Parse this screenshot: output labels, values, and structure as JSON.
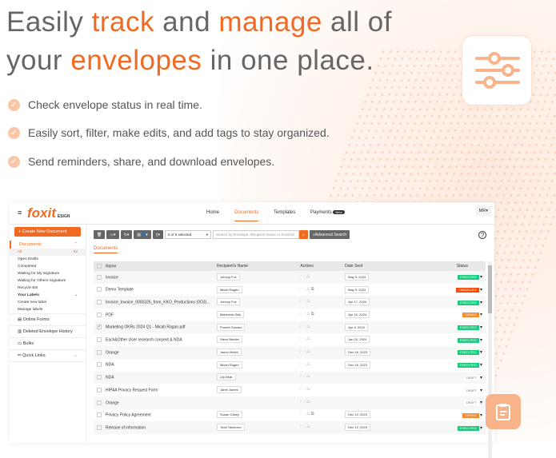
{
  "headline": {
    "l1a": "Easily ",
    "l1b": "track",
    "l1c": " and ",
    "l1d": "manage",
    "l1e": " all of",
    "l2a": "your ",
    "l2b": "envelopes",
    "l2c": " in one place."
  },
  "bullets": [
    "Check envelope status in real time.",
    "Easily sort, filter, make edits, and add tags to stay organized.",
    "Send reminders, share, and download envelopes."
  ],
  "app": {
    "logo": "foxit",
    "logo_sub": "ESIGN",
    "nav": [
      "Home",
      "Documents",
      "Templates",
      "Payments"
    ],
    "beta": "Beta",
    "user": "MR",
    "create": "+ Create New Document",
    "sidebar": {
      "documents": "Documents",
      "all": "All",
      "all_count": "62",
      "items": [
        "Open Drafts",
        "Completed",
        "Waiting for My Signature",
        "Waiting for Others Signature",
        "Recycle Bin"
      ],
      "labels": "Your Labels",
      "label_items": [
        "Create new label",
        "Manage labels"
      ],
      "big": [
        "Online Forms",
        "Deleted Envelope History",
        "Bulks",
        "Quick Links"
      ]
    },
    "toolbar": {
      "selected": "6 of 6 selected",
      "search_placeholder": "Search by Envelope, Recipient Name or Email Id",
      "advanced": "Advanced Search"
    },
    "tab": "Documents",
    "columns": [
      "Name",
      "Recipient's Name",
      "Actions",
      "Date Sent",
      "Status"
    ],
    "rows": [
      {
        "name": "Invoice",
        "recipient": "Johnny Fox",
        "date": "May 9, 2024",
        "status": "EXECUTED"
      },
      {
        "name": "Demo Template",
        "recipient": "Micah Ragen",
        "date": "May 9, 2024",
        "status": "CANCELLED"
      },
      {
        "name": "Invoice_Invoice_0000326_from_KKO_Productions (0O3)...",
        "recipient": "Johnny Fox",
        "date": "Apr 17, 2024",
        "status": "EXECUTED"
      },
      {
        "name": "PDF",
        "recipient": "Mahender Bist",
        "date": "Apr 10, 2024",
        "status": "SIGNED"
      },
      {
        "name": "Marketing OKRs 2024 Q1 - Micah Ragan.pdf",
        "recipient": "Puneet Golvani",
        "date": "Apr 9, 2024",
        "status": "EXECUTED",
        "checked": true
      },
      {
        "name": "Each&Other User research consent & NDA",
        "recipient": "Steve Bentler",
        "date": "Jan 24, 2024",
        "status": "EXECUTED"
      },
      {
        "name": "Orange",
        "recipient": "Jason Welch",
        "date": "Dec 16, 2023",
        "status": "EXECUTED"
      },
      {
        "name": "NDA",
        "recipient": "Micah Ragen",
        "date": "Dec 16, 2023",
        "status": "EXECUTED"
      },
      {
        "name": "NDA",
        "recipient": "Lily Bear",
        "date": "",
        "status": "DRAFT"
      },
      {
        "name": "HIPAA Privacy Request Form",
        "recipient": "Janet James",
        "date": "",
        "status": "DRAFT"
      },
      {
        "name": "Orange",
        "recipient": "",
        "date": "",
        "status": "DRAFT"
      },
      {
        "name": "Privacy Policy Agreement",
        "recipient": "Susan Casey",
        "date": "Dec 12, 2023",
        "status": "SIGNED"
      },
      {
        "name": "Release of information",
        "recipient": "Todd Tamburro",
        "date": "Dec 12, 2023",
        "status": "EXECUTED"
      }
    ]
  },
  "colors": {
    "accent": "#f26a21",
    "executed": "#1ec97e",
    "cancelled": "#f24c0c",
    "signed": "#f58a2b"
  }
}
